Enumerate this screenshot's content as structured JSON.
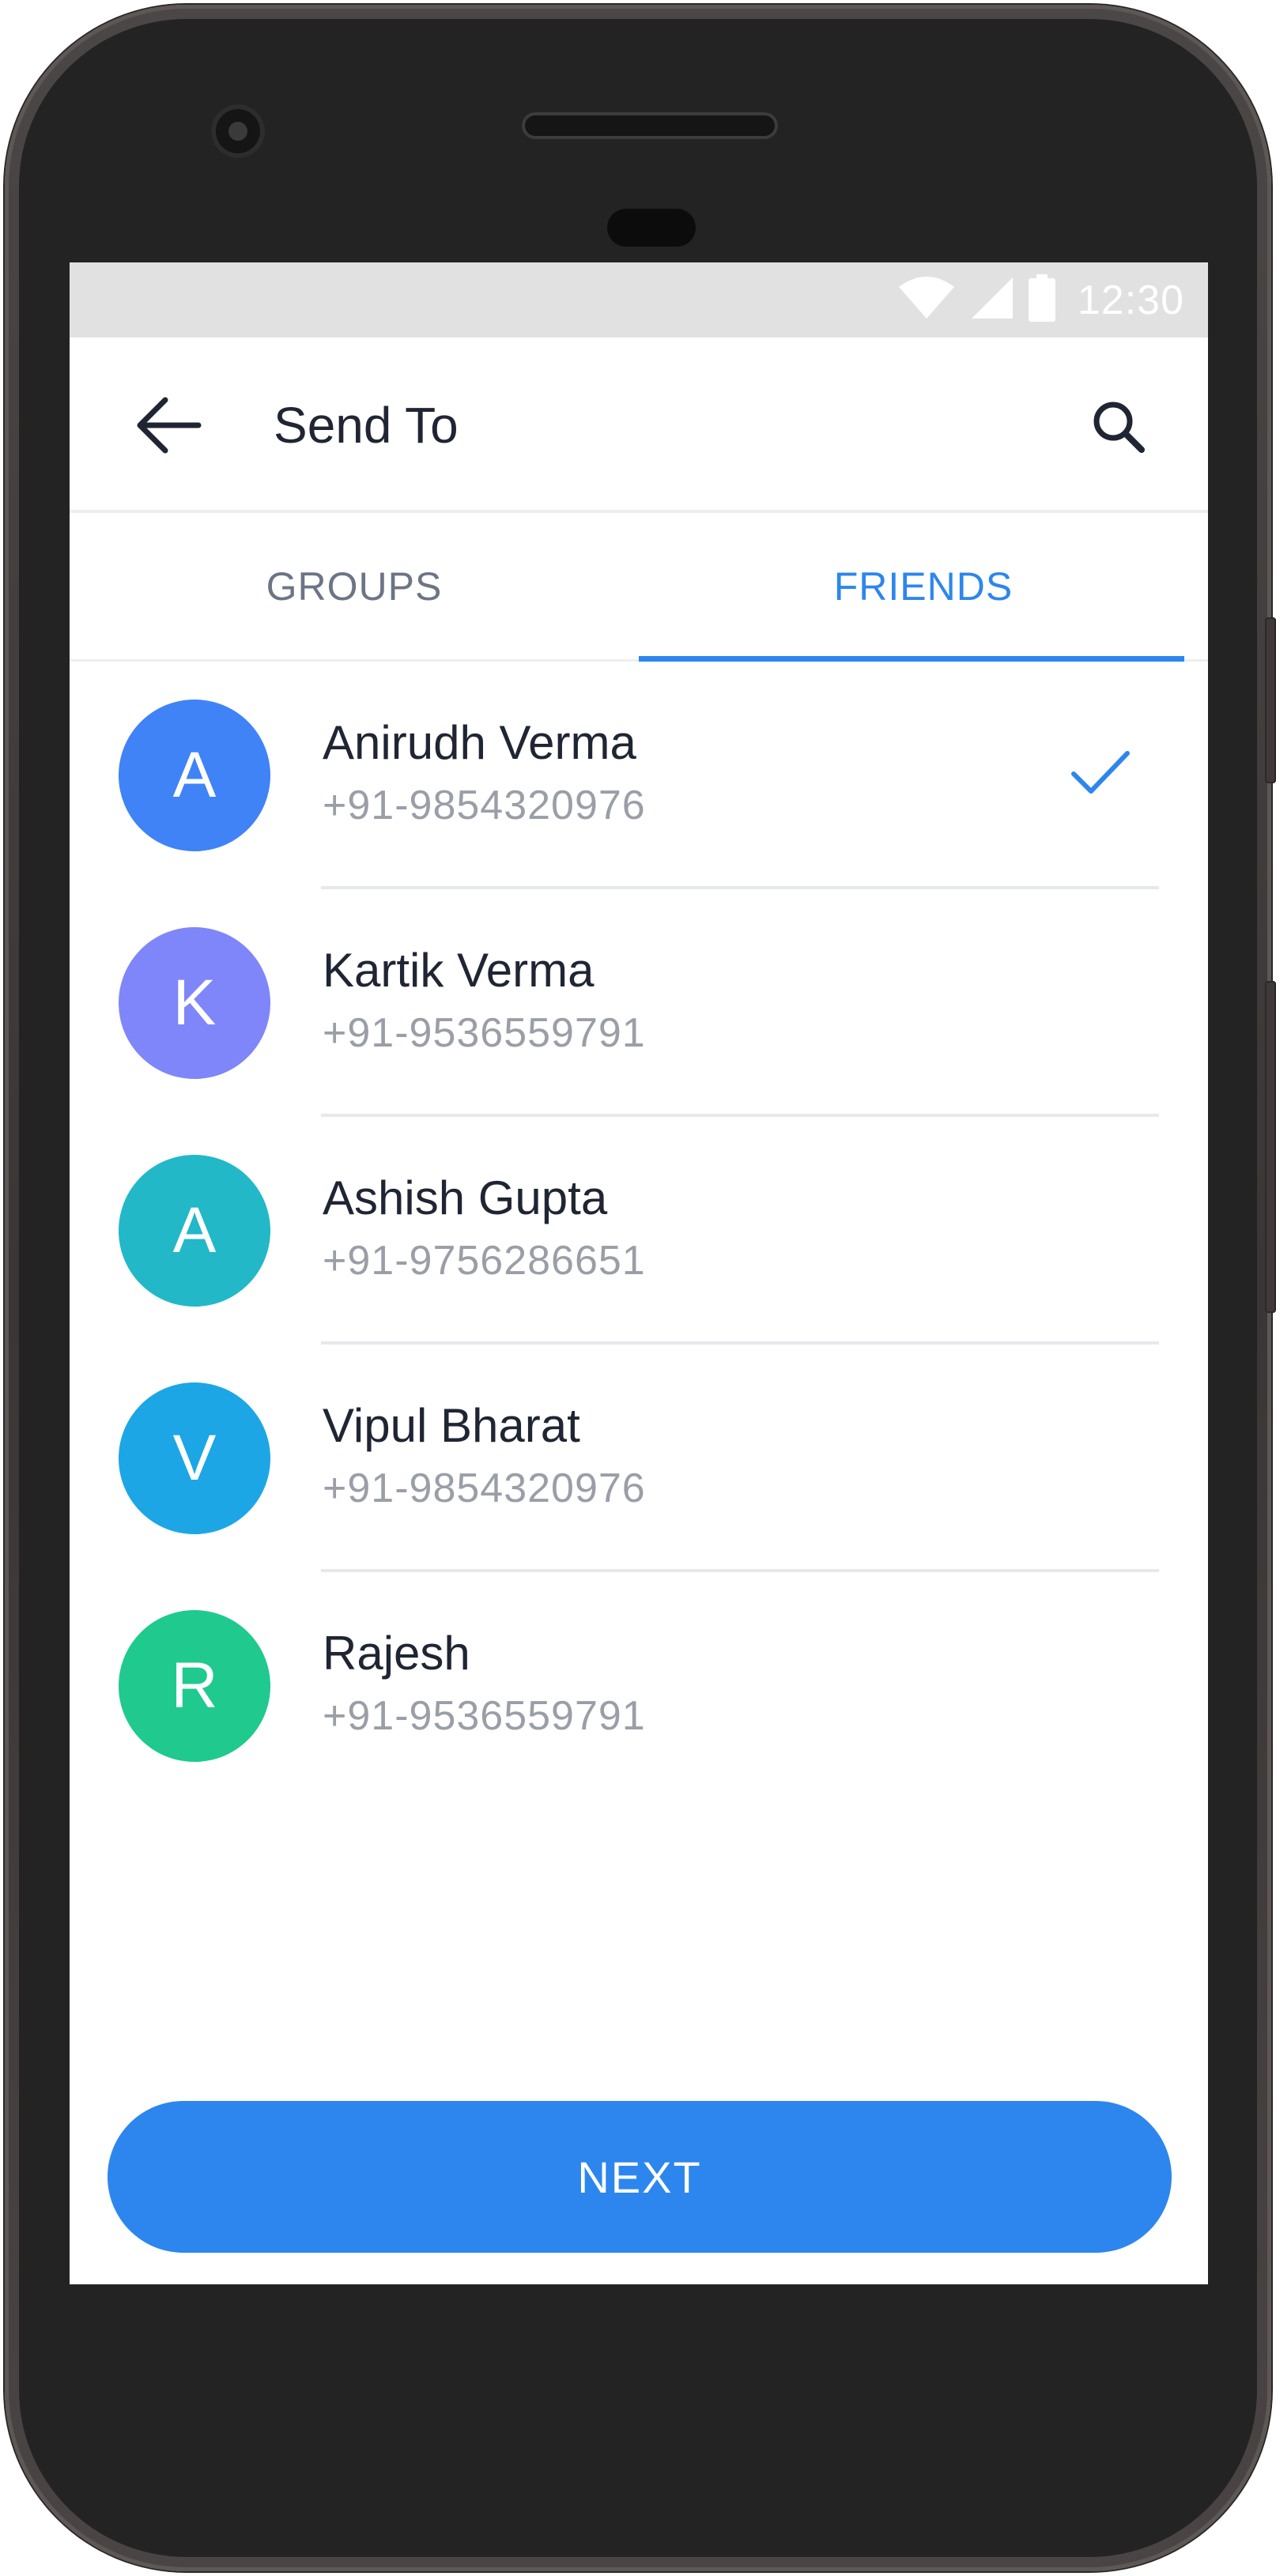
{
  "status_bar": {
    "time": "12:30",
    "icons": [
      "wifi-icon",
      "signal-icon",
      "battery-icon"
    ]
  },
  "app_bar": {
    "title": "Send To",
    "back_icon": "arrow-left-icon",
    "search_icon": "search-icon"
  },
  "tabs": [
    {
      "label": "GROUPS",
      "active": false
    },
    {
      "label": "FRIENDS",
      "active": true
    }
  ],
  "contacts": [
    {
      "initial": "A",
      "name": "Anirudh Verma",
      "phone": "+91-9854320976",
      "color": "#3f83f6",
      "selected": true
    },
    {
      "initial": "K",
      "name": "Kartik Verma",
      "phone": "+91-9536559791",
      "color": "#7f86f9",
      "selected": false
    },
    {
      "initial": "A",
      "name": "Ashish Gupta",
      "phone": "+91-9756286651",
      "color": "#22b8c8",
      "selected": false
    },
    {
      "initial": "V",
      "name": "Vipul Bharat",
      "phone": "+91-9854320976",
      "color": "#1ca6e6",
      "selected": false
    },
    {
      "initial": "R",
      "name": "Rajesh",
      "phone": "+91-9536559791",
      "color": "#20c98e",
      "selected": false
    }
  ],
  "next_button": {
    "label": "NEXT"
  },
  "colors": {
    "accent": "#2d86ee",
    "title_text": "#1f2533",
    "secondary_text": "#9a9ea7"
  }
}
